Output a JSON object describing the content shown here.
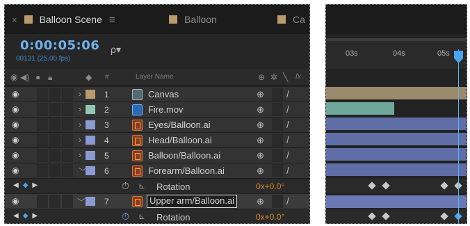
{
  "tabs": [
    {
      "label": "Balloon Scene",
      "active": true
    },
    {
      "label": "Balloon",
      "active": false
    },
    {
      "label": "Ca",
      "active": false
    }
  ],
  "time": {
    "timecode": "0:00:05:06",
    "frames": "00131 (25.00 fps)"
  },
  "search": {
    "icon": "search-icon",
    "glyph": "ρ▾"
  },
  "header": {
    "layer_name": "Layer Name",
    "hash": "#",
    "fx": "fx"
  },
  "layers": [
    {
      "num": "1",
      "name": "Canvas",
      "label_color": "#b89a6b",
      "icon": "comp",
      "expanded": false
    },
    {
      "num": "2",
      "name": "Fire.mov",
      "label_color": "#8ec7b3",
      "icon": "mov",
      "expanded": false
    },
    {
      "num": "3",
      "name": "Eyes/Balloon.ai",
      "label_color": "#8a9bd3",
      "icon": "ai",
      "expanded": false
    },
    {
      "num": "4",
      "name": "Head/Balloon.ai",
      "label_color": "#8a9bd3",
      "icon": "ai",
      "expanded": false
    },
    {
      "num": "5",
      "name": "Balloon/Balloon.ai",
      "label_color": "#8a9bd3",
      "icon": "ai",
      "expanded": false
    },
    {
      "num": "6",
      "name": "Forearm/Balloon.ai",
      "label_color": "#8a9bd3",
      "icon": "ai",
      "expanded": true
    }
  ],
  "prop1": {
    "name": "Rotation",
    "value": "0x+0.0°"
  },
  "layer7": {
    "num": "7",
    "name": "Upper arm/Balloon.ai",
    "label_color": "#8a9bd3"
  },
  "prop2": {
    "name": "Rotation",
    "value": "0x+0.0°"
  },
  "ruler_ticks": [
    "03s",
    "04s",
    "05s"
  ],
  "colors": {
    "timecode": "#6fb3f0",
    "accent": "#4aa6ee",
    "bar_tan": "#9b8a6c",
    "bar_teal": "#6fa89a",
    "bar_blue": "#5f6ea6"
  }
}
